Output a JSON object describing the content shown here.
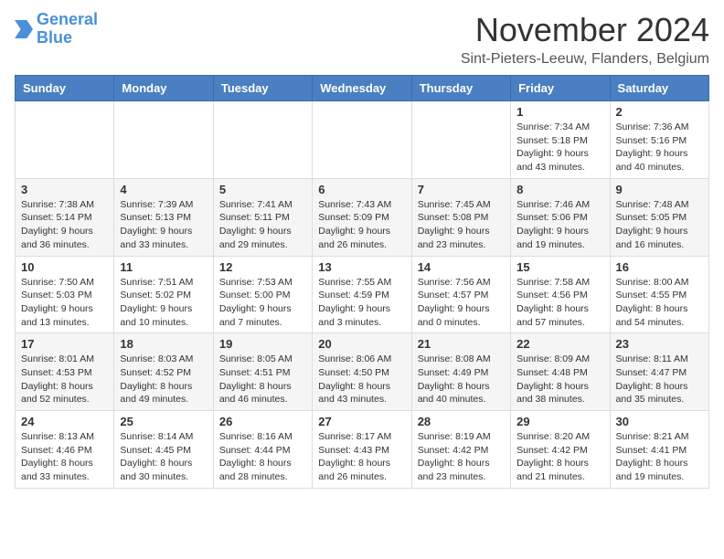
{
  "header": {
    "logo_line1": "General",
    "logo_line2": "Blue",
    "title": "November 2024",
    "subtitle": "Sint-Pieters-Leeuw, Flanders, Belgium"
  },
  "weekdays": [
    "Sunday",
    "Monday",
    "Tuesday",
    "Wednesday",
    "Thursday",
    "Friday",
    "Saturday"
  ],
  "weeks": [
    [
      {
        "day": "",
        "info": ""
      },
      {
        "day": "",
        "info": ""
      },
      {
        "day": "",
        "info": ""
      },
      {
        "day": "",
        "info": ""
      },
      {
        "day": "",
        "info": ""
      },
      {
        "day": "1",
        "info": "Sunrise: 7:34 AM\nSunset: 5:18 PM\nDaylight: 9 hours and 43 minutes."
      },
      {
        "day": "2",
        "info": "Sunrise: 7:36 AM\nSunset: 5:16 PM\nDaylight: 9 hours and 40 minutes."
      }
    ],
    [
      {
        "day": "3",
        "info": "Sunrise: 7:38 AM\nSunset: 5:14 PM\nDaylight: 9 hours and 36 minutes."
      },
      {
        "day": "4",
        "info": "Sunrise: 7:39 AM\nSunset: 5:13 PM\nDaylight: 9 hours and 33 minutes."
      },
      {
        "day": "5",
        "info": "Sunrise: 7:41 AM\nSunset: 5:11 PM\nDaylight: 9 hours and 29 minutes."
      },
      {
        "day": "6",
        "info": "Sunrise: 7:43 AM\nSunset: 5:09 PM\nDaylight: 9 hours and 26 minutes."
      },
      {
        "day": "7",
        "info": "Sunrise: 7:45 AM\nSunset: 5:08 PM\nDaylight: 9 hours and 23 minutes."
      },
      {
        "day": "8",
        "info": "Sunrise: 7:46 AM\nSunset: 5:06 PM\nDaylight: 9 hours and 19 minutes."
      },
      {
        "day": "9",
        "info": "Sunrise: 7:48 AM\nSunset: 5:05 PM\nDaylight: 9 hours and 16 minutes."
      }
    ],
    [
      {
        "day": "10",
        "info": "Sunrise: 7:50 AM\nSunset: 5:03 PM\nDaylight: 9 hours and 13 minutes."
      },
      {
        "day": "11",
        "info": "Sunrise: 7:51 AM\nSunset: 5:02 PM\nDaylight: 9 hours and 10 minutes."
      },
      {
        "day": "12",
        "info": "Sunrise: 7:53 AM\nSunset: 5:00 PM\nDaylight: 9 hours and 7 minutes."
      },
      {
        "day": "13",
        "info": "Sunrise: 7:55 AM\nSunset: 4:59 PM\nDaylight: 9 hours and 3 minutes."
      },
      {
        "day": "14",
        "info": "Sunrise: 7:56 AM\nSunset: 4:57 PM\nDaylight: 9 hours and 0 minutes."
      },
      {
        "day": "15",
        "info": "Sunrise: 7:58 AM\nSunset: 4:56 PM\nDaylight: 8 hours and 57 minutes."
      },
      {
        "day": "16",
        "info": "Sunrise: 8:00 AM\nSunset: 4:55 PM\nDaylight: 8 hours and 54 minutes."
      }
    ],
    [
      {
        "day": "17",
        "info": "Sunrise: 8:01 AM\nSunset: 4:53 PM\nDaylight: 8 hours and 52 minutes."
      },
      {
        "day": "18",
        "info": "Sunrise: 8:03 AM\nSunset: 4:52 PM\nDaylight: 8 hours and 49 minutes."
      },
      {
        "day": "19",
        "info": "Sunrise: 8:05 AM\nSunset: 4:51 PM\nDaylight: 8 hours and 46 minutes."
      },
      {
        "day": "20",
        "info": "Sunrise: 8:06 AM\nSunset: 4:50 PM\nDaylight: 8 hours and 43 minutes."
      },
      {
        "day": "21",
        "info": "Sunrise: 8:08 AM\nSunset: 4:49 PM\nDaylight: 8 hours and 40 minutes."
      },
      {
        "day": "22",
        "info": "Sunrise: 8:09 AM\nSunset: 4:48 PM\nDaylight: 8 hours and 38 minutes."
      },
      {
        "day": "23",
        "info": "Sunrise: 8:11 AM\nSunset: 4:47 PM\nDaylight: 8 hours and 35 minutes."
      }
    ],
    [
      {
        "day": "24",
        "info": "Sunrise: 8:13 AM\nSunset: 4:46 PM\nDaylight: 8 hours and 33 minutes."
      },
      {
        "day": "25",
        "info": "Sunrise: 8:14 AM\nSunset: 4:45 PM\nDaylight: 8 hours and 30 minutes."
      },
      {
        "day": "26",
        "info": "Sunrise: 8:16 AM\nSunset: 4:44 PM\nDaylight: 8 hours and 28 minutes."
      },
      {
        "day": "27",
        "info": "Sunrise: 8:17 AM\nSunset: 4:43 PM\nDaylight: 8 hours and 26 minutes."
      },
      {
        "day": "28",
        "info": "Sunrise: 8:19 AM\nSunset: 4:42 PM\nDaylight: 8 hours and 23 minutes."
      },
      {
        "day": "29",
        "info": "Sunrise: 8:20 AM\nSunset: 4:42 PM\nDaylight: 8 hours and 21 minutes."
      },
      {
        "day": "30",
        "info": "Sunrise: 8:21 AM\nSunset: 4:41 PM\nDaylight: 8 hours and 19 minutes."
      }
    ]
  ]
}
